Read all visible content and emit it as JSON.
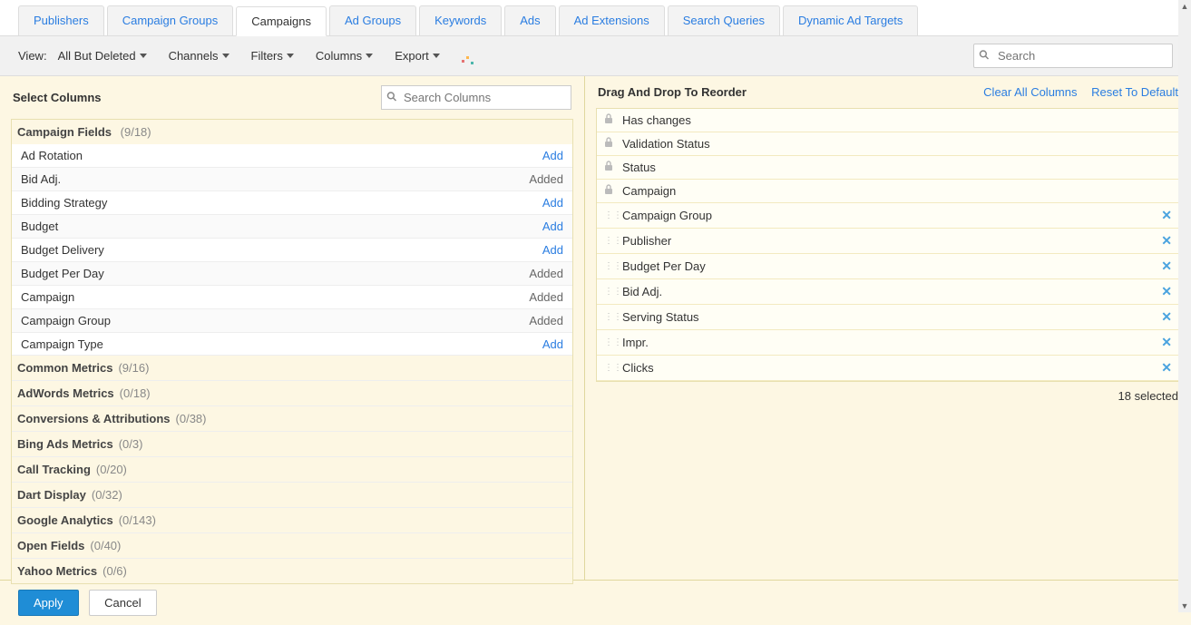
{
  "tabs": [
    "Publishers",
    "Campaign Groups",
    "Campaigns",
    "Ad Groups",
    "Keywords",
    "Ads",
    "Ad Extensions",
    "Search Queries",
    "Dynamic Ad Targets"
  ],
  "activeTab": 2,
  "toolbar": {
    "viewLabel": "View:",
    "view": "All But Deleted",
    "channels": "Channels",
    "filters": "Filters",
    "columns": "Columns",
    "export": "Export",
    "searchPlaceholder": "Search"
  },
  "leftTitle": "Select Columns",
  "colSearchPlaceholder": "Search Columns",
  "firstGroup": {
    "name": "Campaign Fields",
    "count": "(9/18)"
  },
  "fields": [
    {
      "name": "Ad Rotation",
      "state": "Add"
    },
    {
      "name": "Bid Adj.",
      "state": "Added"
    },
    {
      "name": "Bidding Strategy",
      "state": "Add"
    },
    {
      "name": "Budget",
      "state": "Add"
    },
    {
      "name": "Budget Delivery",
      "state": "Add"
    },
    {
      "name": "Budget Per Day",
      "state": "Added"
    },
    {
      "name": "Campaign",
      "state": "Added"
    },
    {
      "name": "Campaign Group",
      "state": "Added"
    },
    {
      "name": "Campaign Type",
      "state": "Add"
    }
  ],
  "groups": [
    {
      "name": "Common Metrics",
      "count": "(9/16)"
    },
    {
      "name": "AdWords Metrics",
      "count": "(0/18)"
    },
    {
      "name": "Conversions & Attributions",
      "count": "(0/38)"
    },
    {
      "name": "Bing Ads Metrics",
      "count": "(0/3)"
    },
    {
      "name": "Call Tracking",
      "count": "(0/20)"
    },
    {
      "name": "Dart Display",
      "count": "(0/32)"
    },
    {
      "name": "Google Analytics",
      "count": "(0/143)"
    },
    {
      "name": "Open Fields",
      "count": "(0/40)"
    },
    {
      "name": "Yahoo Metrics",
      "count": "(0/6)"
    }
  ],
  "rightTitle": "Drag And Drop To Reorder",
  "clearAll": "Clear All Columns",
  "resetDefault": "Reset To Default",
  "reorder": [
    {
      "label": "Has changes",
      "locked": true
    },
    {
      "label": "Validation Status",
      "locked": true
    },
    {
      "label": "Status",
      "locked": true
    },
    {
      "label": "Campaign",
      "locked": true
    },
    {
      "label": "Campaign Group",
      "locked": false
    },
    {
      "label": "Publisher",
      "locked": false
    },
    {
      "label": "Budget Per Day",
      "locked": false
    },
    {
      "label": "Bid Adj.",
      "locked": false
    },
    {
      "label": "Serving Status",
      "locked": false
    },
    {
      "label": "Impr.",
      "locked": false
    },
    {
      "label": "Clicks",
      "locked": false
    }
  ],
  "selectedCount": "18 selected",
  "applyLabel": "Apply",
  "cancelLabel": "Cancel"
}
